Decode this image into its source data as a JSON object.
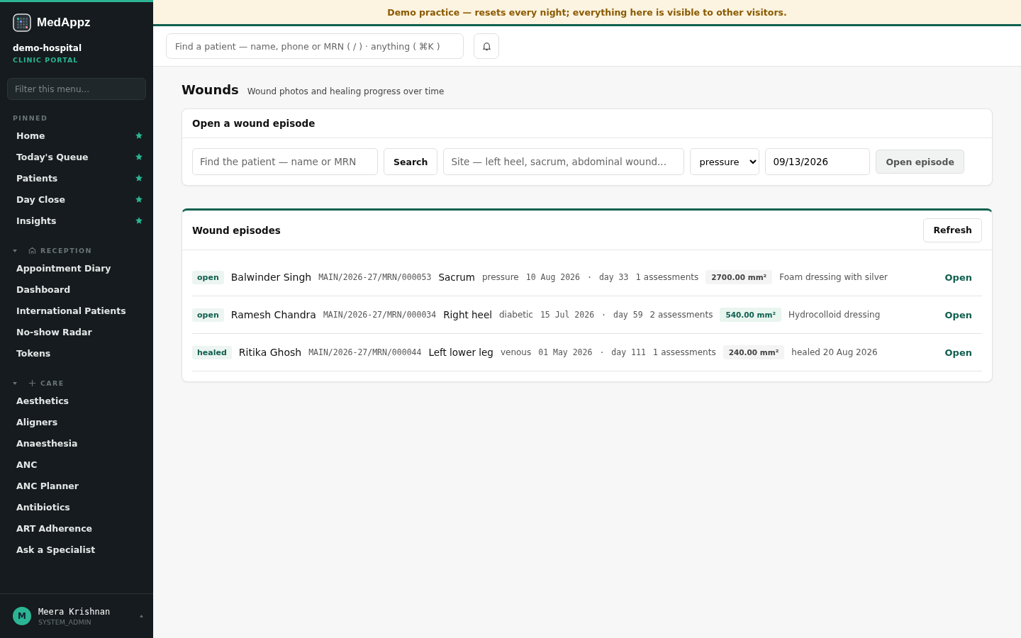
{
  "brand": {
    "name": "MedAppz",
    "org": "demo-hospital",
    "portal": "CLINIC PORTAL"
  },
  "sidebar": {
    "filter_placeholder": "Filter this menu...",
    "pinned": {
      "title": "PINNED",
      "items": [
        {
          "label": "Home",
          "starred": true
        },
        {
          "label": "Today's Queue",
          "starred": true
        },
        {
          "label": "Patients",
          "starred": true
        },
        {
          "label": "Day Close",
          "starred": true
        },
        {
          "label": "Insights",
          "starred": true
        }
      ]
    },
    "sections": [
      {
        "title": "RECEPTION",
        "kind": "reception",
        "expanded": true,
        "items": [
          "Appointment Diary",
          "Dashboard",
          "International Patients",
          "No-show Radar",
          "Tokens"
        ]
      },
      {
        "title": "CARE",
        "kind": "care",
        "expanded": true,
        "items": [
          "Aesthetics",
          "Aligners",
          "Anaesthesia",
          "ANC",
          "ANC Planner",
          "Antibiotics",
          "ART Adherence",
          "Ask a Specialist"
        ]
      }
    ],
    "user": {
      "initial": "M",
      "name": "Meera Krishnan",
      "role": "SYSTEM_ADMIN"
    }
  },
  "banner": "Demo practice — resets every night; everything here is visible to other visitors.",
  "search": {
    "placeholder": "Find a patient — name, phone or MRN ( / ) · anything ( ⌘K )"
  },
  "page": {
    "title": "Wounds",
    "subtitle": "Wound photos and healing progress over time"
  },
  "open_form": {
    "title": "Open a wound episode",
    "patient_placeholder": "Find the patient — name or MRN",
    "search_button": "Search",
    "site_placeholder": "Site — left heel, sacrum, abdominal wound...",
    "type": "pressure",
    "date": "09/13/2026",
    "submit": "Open episode",
    "submit_disabled": true
  },
  "episodes": {
    "title": "Wound episodes",
    "refresh": "Refresh",
    "rows": [
      {
        "status": "open",
        "patient": "Balwinder Singh",
        "mrn": "MAIN/2026-27/MRN/000053",
        "site": "Sacrum",
        "type": "pressure",
        "date": "10 Aug 2026",
        "separator": "·",
        "day": "day 33",
        "assessments": "1 assessments",
        "area": "2700.00 mm²",
        "area_improving": false,
        "note": "Foam dressing with silver",
        "action": "Open"
      },
      {
        "status": "open",
        "patient": "Ramesh Chandra",
        "mrn": "MAIN/2026-27/MRN/000034",
        "site": "Right heel",
        "type": "diabetic",
        "date": "15 Jul 2026",
        "separator": "·",
        "day": "day 59",
        "assessments": "2 assessments",
        "area": "540.00 mm²",
        "area_improving": true,
        "note": "Hydrocolloid dressing",
        "action": "Open"
      },
      {
        "status": "healed",
        "patient": "Ritika Ghosh",
        "mrn": "MAIN/2026-27/MRN/000044",
        "site": "Left lower leg",
        "type": "venous",
        "date": "01 May 2026",
        "separator": "·",
        "day": "day 111",
        "assessments": "1 assessments",
        "area": "240.00 mm²",
        "area_improving": false,
        "note": "healed 20 Aug 2026",
        "action": "Open"
      }
    ]
  }
}
